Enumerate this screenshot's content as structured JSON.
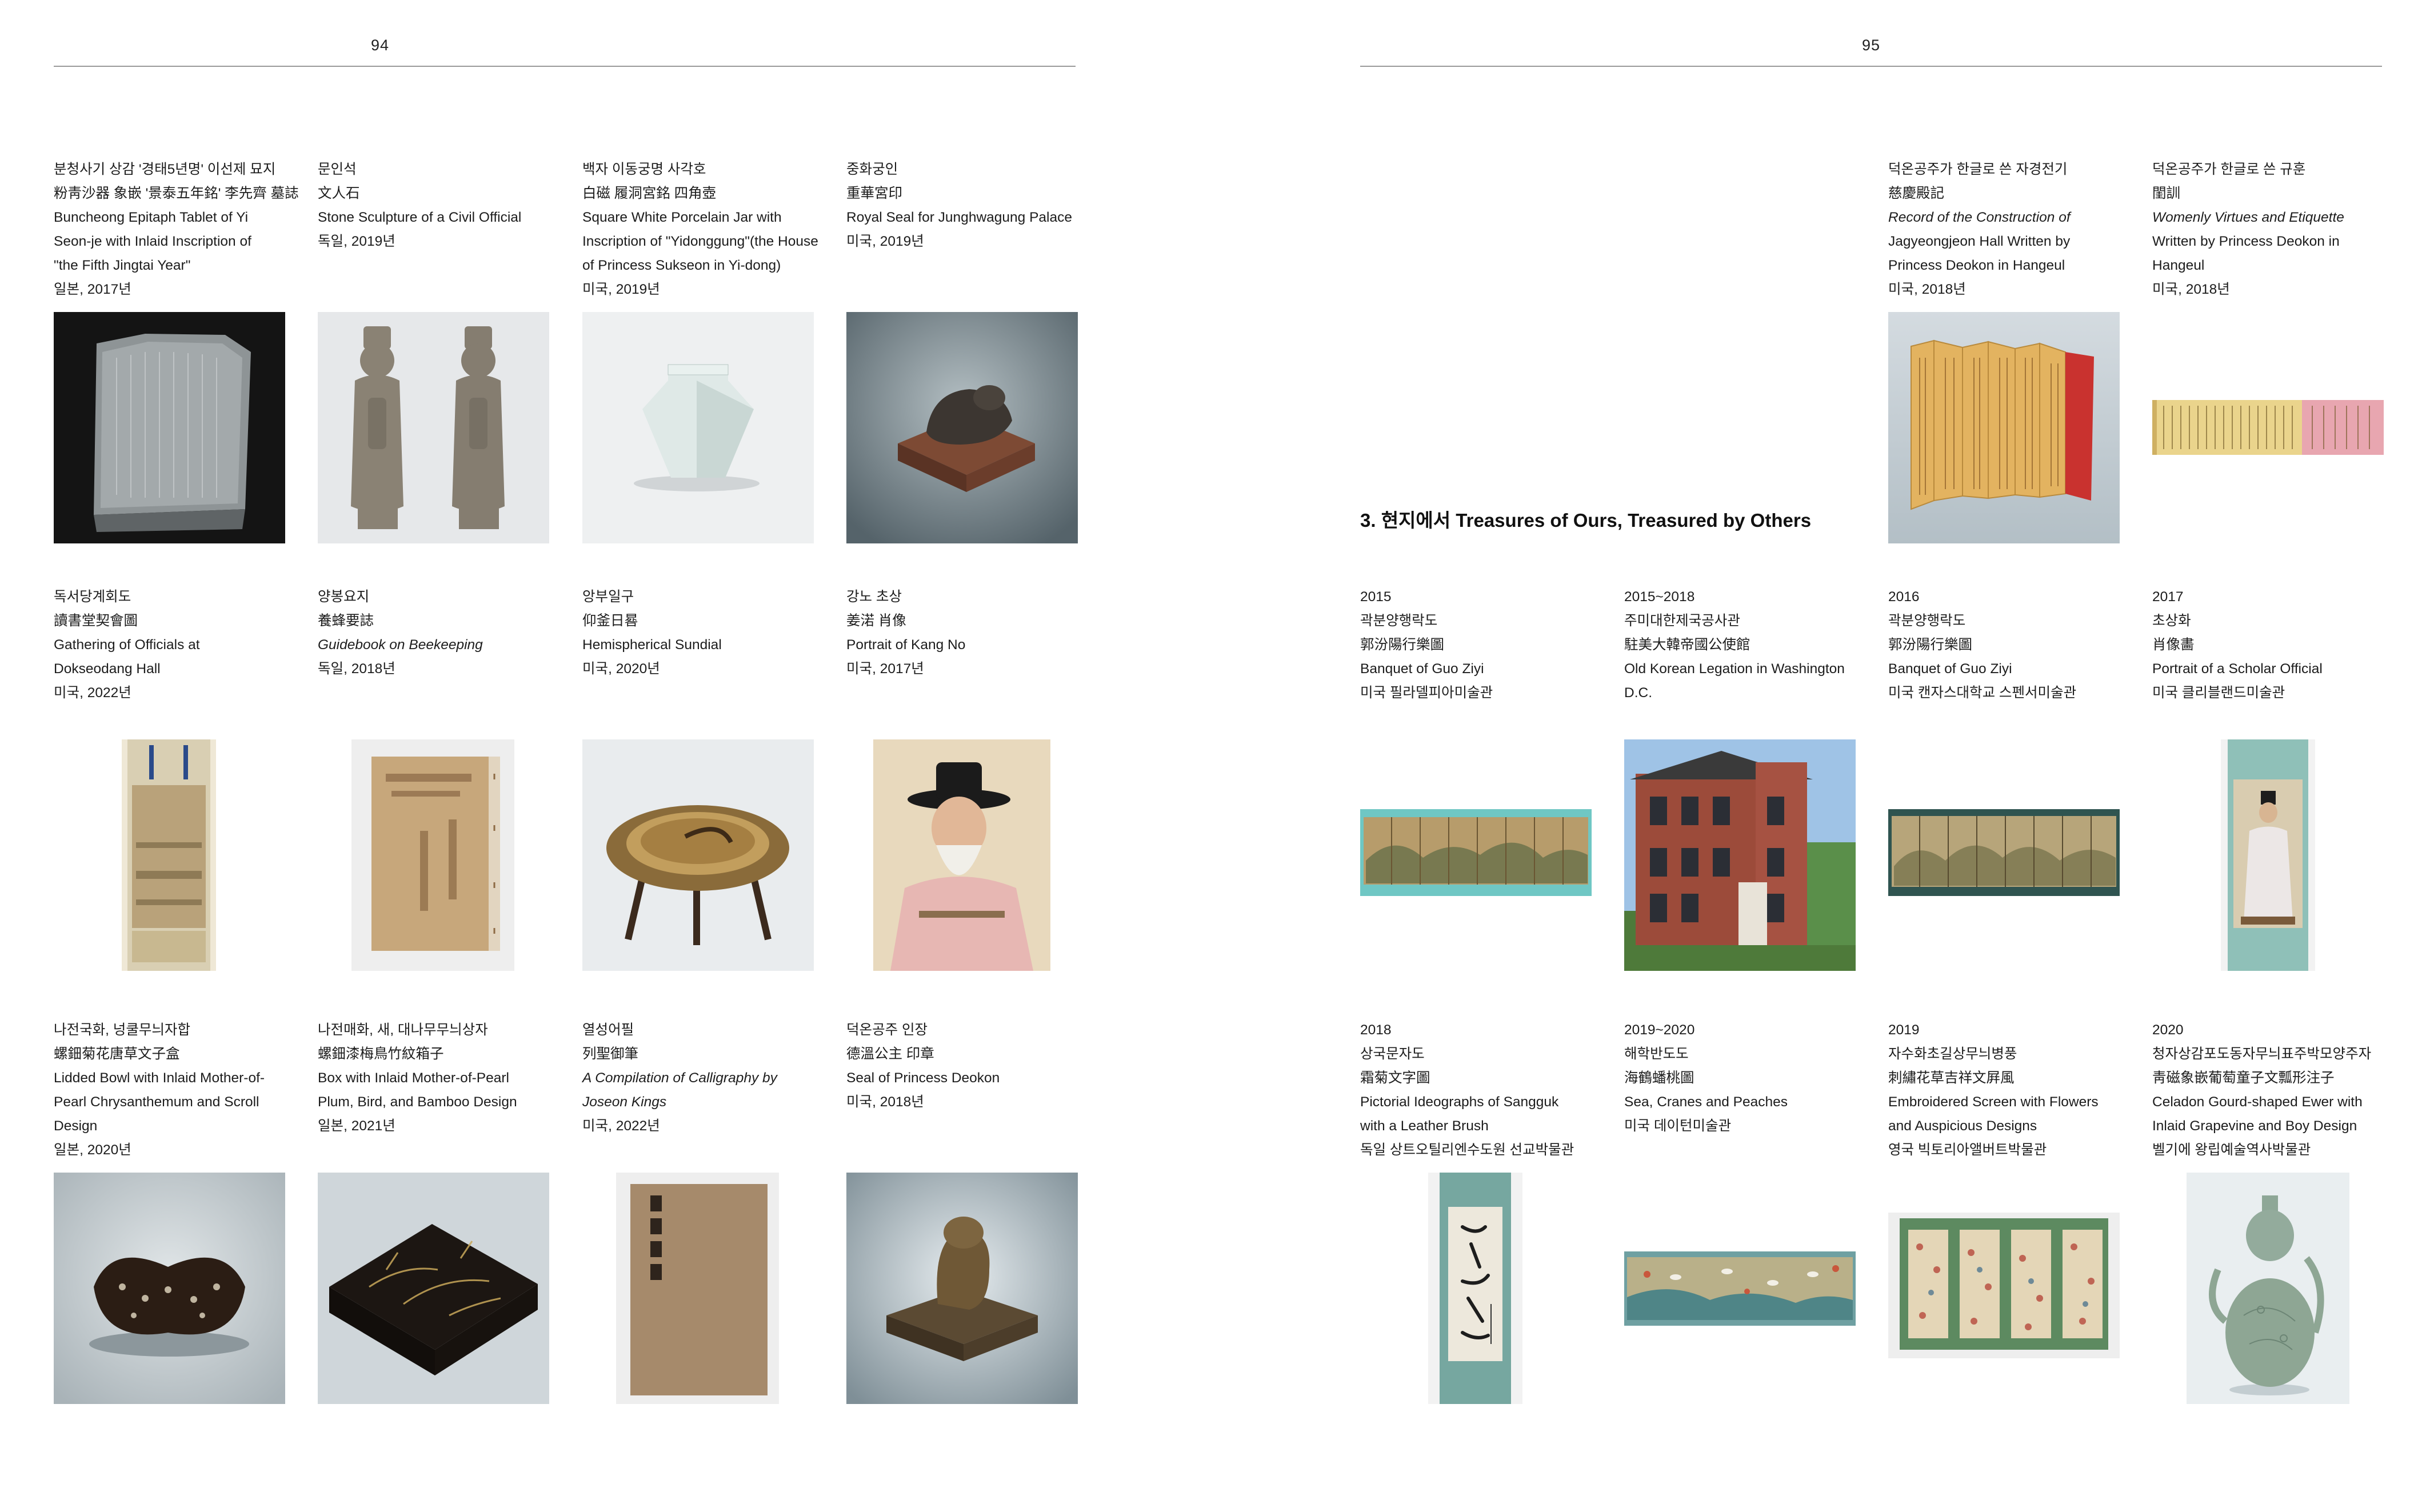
{
  "left_page": {
    "page_number": "94",
    "items": [
      {
        "lines": [
          "분청사기 상감 '경태5년명' 이선제 묘지",
          "粉靑沙器 象嵌 '景泰五年銘' 李先齊 墓誌",
          "Buncheong Epitaph Tablet of Yi",
          "Seon-je with Inlaid Inscription of",
          "\"the Fifth Jingtai Year\"",
          "일본, 2017년"
        ],
        "image": "epitaph-tablet"
      },
      {
        "lines": [
          "문인석",
          "文人石",
          "Stone Sculpture of a Civil Official",
          "독일, 2019년"
        ],
        "image": "stone-officials"
      },
      {
        "lines": [
          "백자 이동궁명 사각호",
          "白磁 履洞宮銘 四角壺",
          "Square White Porcelain Jar with",
          "Inscription of \"Yidonggung\"(the House",
          "of Princess Sukseon in Yi-dong)",
          "미국, 2019년"
        ],
        "image": "white-jar"
      },
      {
        "lines": [
          "중화궁인",
          "重華宮印",
          "Royal Seal for Junghwagung Palace",
          "미국, 2019년"
        ],
        "image": "royal-seal"
      },
      {
        "lines": [
          "독서당계회도",
          "讀書堂契會圖",
          "Gathering of Officials at",
          "Dokseodang Hall",
          "미국, 2022년"
        ],
        "image": "hanging-scroll-landscape"
      },
      {
        "lines": [
          "양봉요지",
          "養蜂要誌",
          "Guidebook on Beekeeping",
          "독일, 2018년"
        ],
        "italic": [
          2
        ],
        "image": "old-book"
      },
      {
        "lines": [
          "앙부일구",
          "仰釜日晷",
          "Hemispherical Sundial",
          "미국, 2020년"
        ],
        "image": "sundial"
      },
      {
        "lines": [
          "강노 초상",
          "姜渃 肖像",
          "Portrait of Kang No",
          "미국, 2017년"
        ],
        "image": "portrait-kang-no"
      },
      {
        "lines": [
          "나전국화, 넝쿨무늬자합",
          "螺鈿菊花唐草文子盒",
          "Lidded Bowl with Inlaid Mother-of-",
          "Pearl Chrysanthemum and Scroll",
          "Design",
          "일본, 2020년"
        ],
        "image": "lidded-bowl"
      },
      {
        "lines": [
          "나전매화, 새, 대나무무늬상자",
          "螺鈿漆梅鳥竹紋箱子",
          "Box with Inlaid Mother-of-Pearl",
          "Plum, Bird, and Bamboo Design",
          "일본, 2021년"
        ],
        "image": "lacquer-box"
      },
      {
        "lines": [
          "열성어필",
          "列聖御筆",
          "A Compilation of Calligraphy by",
          "Joseon Kings",
          "미국, 2022년"
        ],
        "italic": [
          2,
          3
        ],
        "image": "calligraphy-book"
      },
      {
        "lines": [
          "덕온공주 인장",
          "德溫公主 印章",
          "Seal of Princess Deokon",
          "미국, 2018년"
        ],
        "image": "princess-seal"
      }
    ]
  },
  "right_page": {
    "page_number": "95",
    "section_title": "3. 현지에서 Treasures of Ours, Treasured by Others",
    "top_items": [
      {
        "lines": [
          "덕온공주가 한글로 쓴 자경전기",
          "慈慶殿記",
          "Record of the Construction of",
          "Jagyeongjeon Hall Written by",
          "Princess Deokon in Hangeul",
          "미국, 2018년"
        ],
        "italic": [
          2,
          3
        ],
        "image": "folding-book"
      },
      {
        "lines": [
          "덕온공주가 한글로 쓴 규훈",
          "閨訓",
          "Womenly Virtues and Etiquette",
          "Written by Princess Deokon in",
          "Hangeul",
          "미국, 2018년"
        ],
        "italic": [
          2
        ],
        "image": "scroll-strip"
      }
    ],
    "items": [
      {
        "lines": [
          "2015",
          "곽분양행락도",
          "郭汾陽行樂圖",
          "Banquet of Guo Ziyi",
          "미국 필라델피아미술관"
        ],
        "image": "folding-screen-banquet"
      },
      {
        "lines": [
          "2015~2018",
          "주미대한제국공사관",
          "駐美大韓帝國公使館",
          "Old Korean Legation in Washington",
          "D.C."
        ],
        "image": "legation-building"
      },
      {
        "lines": [
          "2016",
          "곽분양행락도",
          "郭汾陽行樂圖",
          "Banquet of Guo Ziyi",
          "미국 캔자스대학교 스펜서미술관"
        ],
        "image": "folding-screen-banquet-2"
      },
      {
        "lines": [
          "2017",
          "초상화",
          "肖像畵",
          "Portrait of a Scholar Official",
          "미국 클리블랜드미술관"
        ],
        "image": "scholar-portrait"
      },
      {
        "lines": [
          "2018",
          "상국문자도",
          "霜菊文字圖",
          "Pictorial Ideographs of Sangguk",
          "with a Leather Brush",
          "독일 상트오틸리엔수도원 선교박물관"
        ],
        "image": "ideograph-scroll"
      },
      {
        "lines": [
          "2019~2020",
          "해학반도도",
          "海鶴蟠桃圖",
          "Sea, Cranes and Peaches",
          "미국 데이턴미술관"
        ],
        "image": "cranes-screen"
      },
      {
        "lines": [
          "2019",
          "자수화초길상무늬병풍",
          "刺繡花草吉祥文屛風",
          "Embroidered Screen with Flowers",
          "and Auspicious Designs",
          "영국 빅토리아앨버트박물관"
        ],
        "image": "embroidered-screen"
      },
      {
        "lines": [
          "2020",
          "청자상감포도동자무늬표주박모양주자",
          "靑磁象嵌葡萄童子文瓢形注子",
          "Celadon Gourd-shaped Ewer with",
          "Inlaid Grapevine and Boy Design",
          "벨기에 왕립예술역사박물관"
        ],
        "image": "celadon-ewer"
      }
    ]
  },
  "colors": {
    "rule": "#9a9a9a",
    "text": "#1c1c1c",
    "background": "#ffffff"
  }
}
